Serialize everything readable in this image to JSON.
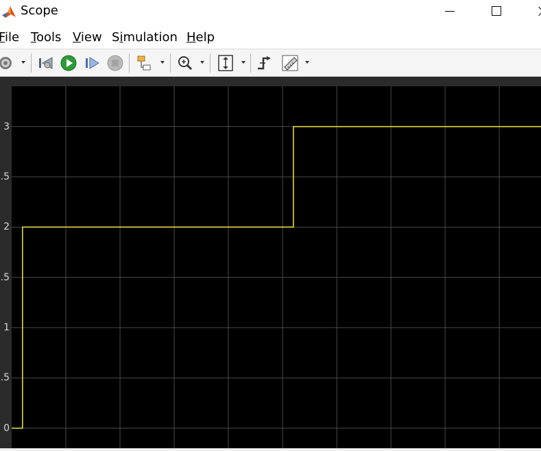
{
  "window": {
    "title": "Scope",
    "app_icon": "matlab-icon",
    "controls": [
      "minimize-icon",
      "maximize-icon",
      "close-icon"
    ]
  },
  "menu": {
    "items": [
      {
        "label": "File",
        "mnemonic": "F"
      },
      {
        "label": "Tools",
        "mnemonic": "T"
      },
      {
        "label": "View",
        "mnemonic": "V"
      },
      {
        "label": "Simulation",
        "mnemonic": "i"
      },
      {
        "label": "Help",
        "mnemonic": "H"
      }
    ]
  },
  "toolbar": {
    "icons": [
      "settings-gear-icon",
      "step-back-icon",
      "run-icon",
      "step-forward-icon",
      "stop-icon",
      "highlight-blocks-icon",
      "zoom-in-icon",
      "autoscale-icon",
      "triggers-icon",
      "measurements-ruler-icon"
    ]
  },
  "chart_data": {
    "type": "line",
    "style": "stairs",
    "line_color": "#e6d83a",
    "background": "#000000",
    "grid": true,
    "title": "",
    "xlabel": "",
    "ylabel": "",
    "ylim": [
      -0.2,
      3.4
    ],
    "xlim": [
      0,
      9.77
    ],
    "y_tick_labels": [
      "3",
      ".5",
      "2",
      ".5",
      "1",
      ".5",
      "0"
    ],
    "y_tick_values": [
      3,
      2.5,
      2,
      1.5,
      1,
      0.5,
      0
    ],
    "series": [
      {
        "x": [
          0,
          0.2,
          0.2,
          5.2,
          5.2,
          9.77
        ],
        "values": [
          0,
          0,
          2,
          2,
          3,
          3
        ]
      }
    ]
  }
}
